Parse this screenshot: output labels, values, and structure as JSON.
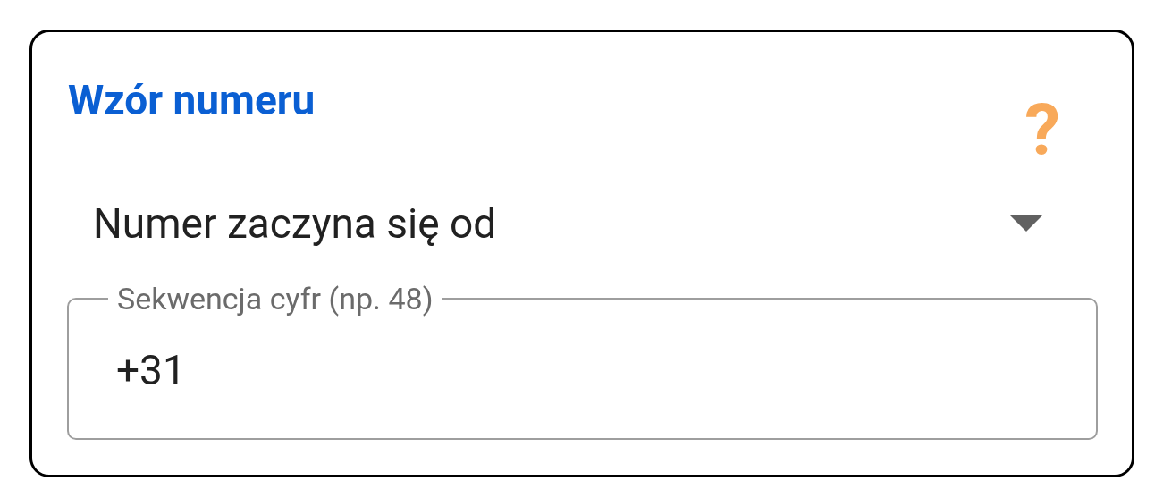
{
  "card": {
    "title": "Wzór numeru",
    "help_icon": "?"
  },
  "dropdown": {
    "value": "Numer zaczyna się od"
  },
  "field": {
    "label": "Sekwencja cyfr (np. 48)",
    "value": "+31"
  }
}
